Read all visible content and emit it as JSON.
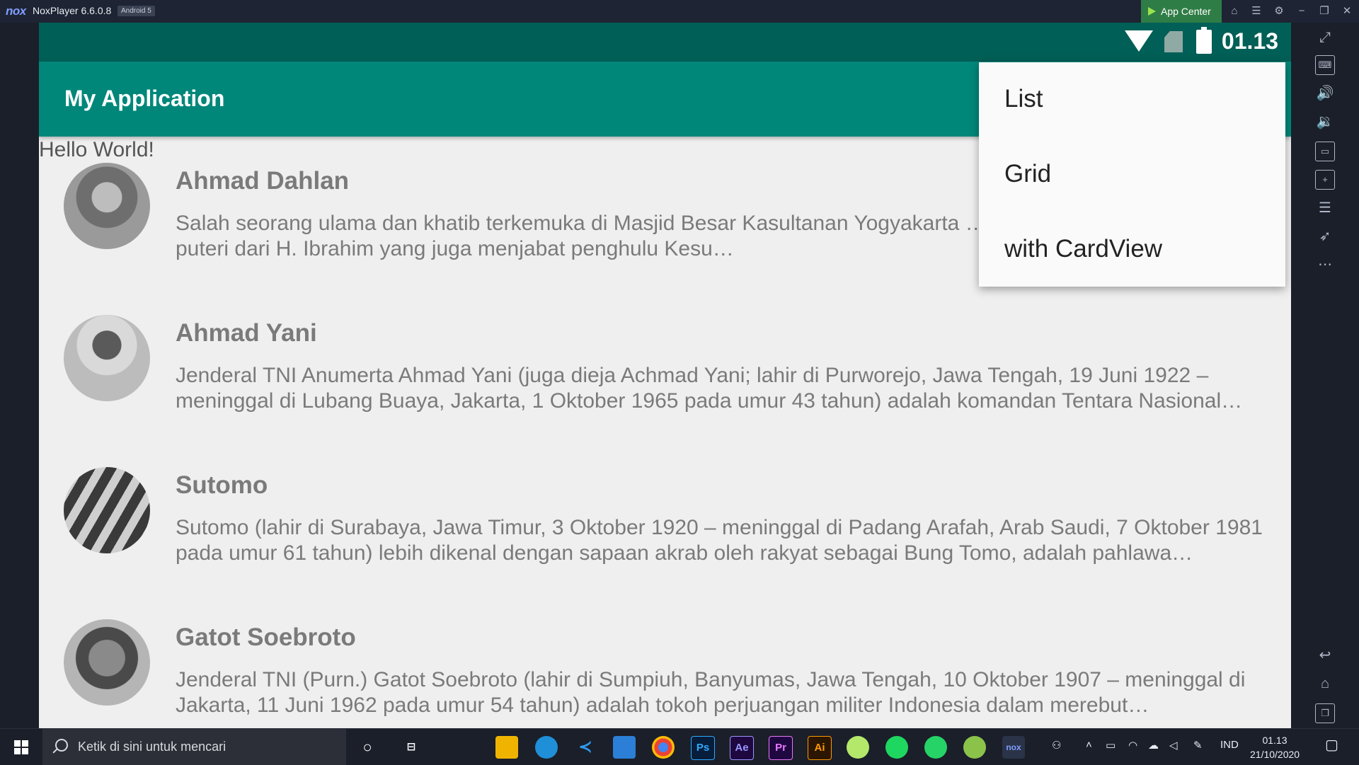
{
  "window": {
    "logo": "nox",
    "title": "NoxPlayer 6.6.0.8",
    "badge": "Android 5",
    "app_center": "App Center"
  },
  "device": {
    "status_time": "01.13"
  },
  "app": {
    "title": "My Application",
    "hello_text": "Hello World!",
    "items": [
      {
        "name": "Ahmad Dahlan",
        "description": "Salah seorang ulama dan khatib terkemuka di Masjid Besar Kasultanan Yogyakarta … K.H. Ahmad Dahlan adalah puteri dari H. Ibrahim yang juga menjabat penghulu Kesu…"
      },
      {
        "name": "Ahmad Yani",
        "description": "Jenderal TNI Anumerta Ahmad Yani (juga dieja Achmad Yani; lahir di Purworejo, Jawa Tengah, 19 Juni 1922 – meninggal di Lubang Buaya, Jakarta, 1 Oktober 1965 pada umur 43 tahun) adalah komandan Tentara Nasional…"
      },
      {
        "name": "Sutomo",
        "description": "Sutomo (lahir di Surabaya, Jawa Timur, 3 Oktober 1920 – meninggal di Padang Arafah, Arab Saudi, 7 Oktober 1981 pada umur 61 tahun) lebih dikenal dengan sapaan akrab oleh rakyat sebagai Bung Tomo, adalah pahlawa…"
      },
      {
        "name": "Gatot Soebroto",
        "description": "Jenderal TNI (Purn.) Gatot Soebroto (lahir di Sumpiuh, Banyumas, Jawa Tengah, 10 Oktober 1907 – meninggal di Jakarta, 11 Juni 1962 pada umur 54 tahun) adalah tokoh perjuangan militer Indonesia dalam merebut…"
      }
    ],
    "menu": {
      "items": [
        "List",
        "Grid",
        "with CardView"
      ]
    }
  },
  "taskbar": {
    "search_placeholder": "Ketik di sini untuk mencari",
    "apps": [
      "Ps",
      "Ae",
      "Pr",
      "Ai"
    ],
    "language": "IND",
    "clock_time": "01.13",
    "clock_date": "21/10/2020"
  },
  "colors": {
    "status_bar": "#005f56",
    "app_bar": "#00877a",
    "content_bg": "#efefef",
    "emulator_bg": "#1b1f2a",
    "app_center": "#2f7d46"
  }
}
